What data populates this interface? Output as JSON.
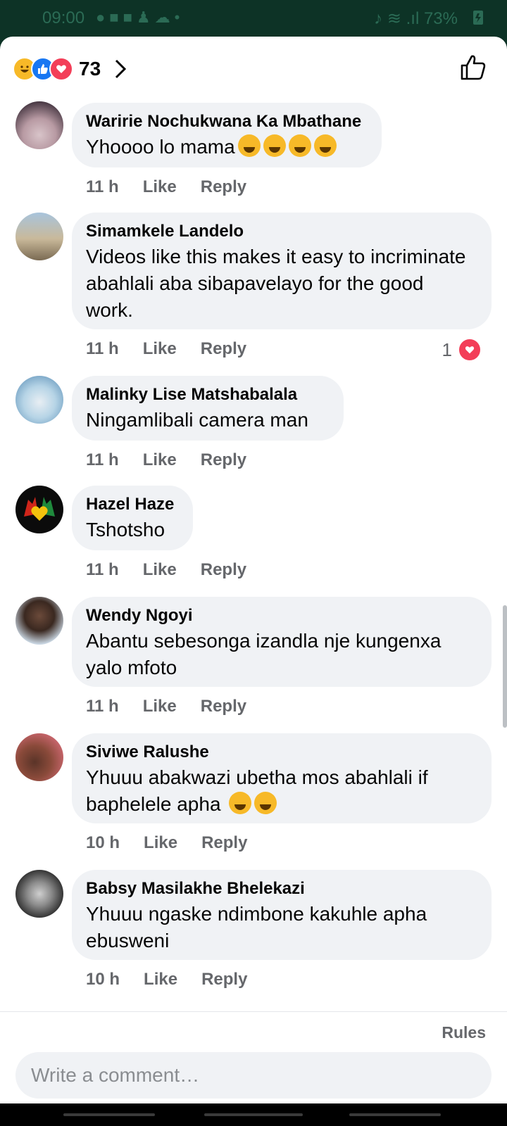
{
  "status_bar": {
    "time": "09:00",
    "notification_icons": [
      "facebook-icon",
      "youtube-icon",
      "youtube-icon",
      "notification-icon",
      "weather-icon",
      "dot-icon"
    ],
    "battery": "73%"
  },
  "reactions": {
    "count": "73",
    "icons": [
      "haha-icon",
      "like-icon",
      "love-icon"
    ]
  },
  "comments": [
    {
      "name": "Waririe Nochukwana Ka Mbathane",
      "text": "Yhoooo lo mama",
      "emojis": 4,
      "time": "11 h",
      "like": "Like",
      "reply": "Reply"
    },
    {
      "name": "Simamkele Landelo",
      "text": "Videos like this makes it easy to incriminate abahlali aba sibapavelayo for the good work.",
      "time": "11 h",
      "like": "Like",
      "reply": "Reply",
      "reaction_count": "1"
    },
    {
      "name": "Malinky Lise Matshabalala",
      "text": "Ningamlibali camera man",
      "time": "11 h",
      "like": "Like",
      "reply": "Reply"
    },
    {
      "name": "Hazel Haze",
      "text": "Tshotsho",
      "time": "11 h",
      "like": "Like",
      "reply": "Reply"
    },
    {
      "name": "Wendy Ngoyi",
      "text": "Abantu sebesonga izandla nje kungenxa yalo mfoto",
      "time": "11 h",
      "like": "Like",
      "reply": "Reply"
    },
    {
      "name": "Siviwe Ralushe",
      "text": "Yhuuu abakwazi ubetha mos abahlali if baphelele apha",
      "emojis": 2,
      "time": "10 h",
      "like": "Like",
      "reply": "Reply"
    },
    {
      "name": "Babsy Masilakhe Bhelekazi",
      "text": "Yhuuu ngaske ndimbone kakuhle apha ebusweni",
      "time": "10 h",
      "like": "Like",
      "reply": "Reply"
    }
  ],
  "footer": {
    "rules": "Rules",
    "placeholder": "Write a comment…"
  }
}
